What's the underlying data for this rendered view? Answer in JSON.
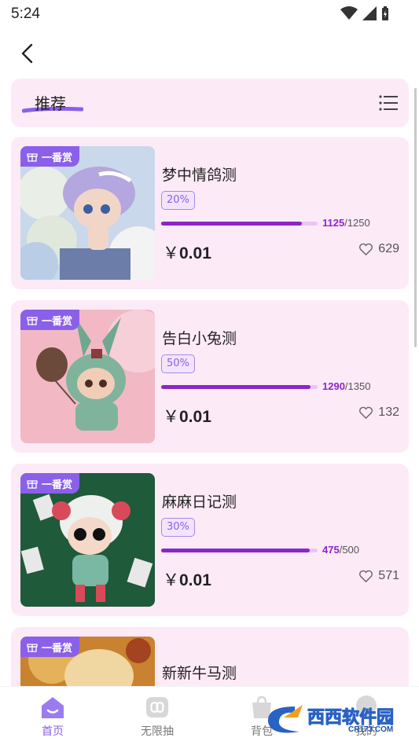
{
  "status": {
    "time": "5:24"
  },
  "header": {
    "title": "推荐"
  },
  "cards": [
    {
      "badge": "一番赏",
      "title": "梦中情鸽测",
      "percent": "20%",
      "progress": 0.9,
      "current": "1125",
      "total": "/1250",
      "currency": "￥",
      "price": "0.01",
      "likes": "629"
    },
    {
      "badge": "一番赏",
      "title": "告白小兔测",
      "percent": "50%",
      "progress": 0.956,
      "current": "1290",
      "total": "/1350",
      "currency": "￥",
      "price": "0.01",
      "likes": "132"
    },
    {
      "badge": "一番赏",
      "title": "麻麻日记测",
      "percent": "30%",
      "progress": 0.95,
      "current": "475",
      "total": "/500",
      "currency": "￥",
      "price": "0.01",
      "likes": "571"
    },
    {
      "badge": "一番赏",
      "title": "新新牛马测"
    }
  ],
  "tabs": [
    {
      "label": "首页",
      "icon": "home-icon"
    },
    {
      "label": "无限抽",
      "icon": "infinity-icon"
    },
    {
      "label": "背包",
      "icon": "bag-icon"
    },
    {
      "label": "我的",
      "icon": "profile-icon"
    }
  ],
  "watermark": {
    "text": "西西软件园",
    "url": "CR173.COM"
  },
  "colors": {
    "accent": "#8a60e8",
    "progress": "#8c26c8",
    "card_bg": "#fdeaf7"
  }
}
